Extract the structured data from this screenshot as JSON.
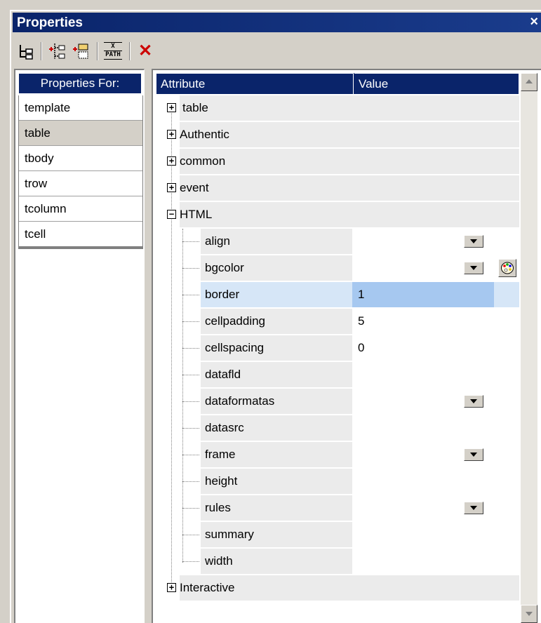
{
  "window": {
    "title": "Properties",
    "close_glyph": "×"
  },
  "toolbar": {
    "buttons": [
      {
        "icon": "tree-view-icon"
      },
      {
        "icon": "add-child-icon"
      },
      {
        "icon": "add-sibling-icon"
      },
      {
        "icon": "xpath-icon",
        "label_top": "X",
        "label_bottom": "PATH"
      },
      {
        "icon": "delete-icon",
        "label": "✕",
        "color": "#cc0000"
      }
    ]
  },
  "left_panel": {
    "header": "Properties For:",
    "items": [
      "template",
      "table",
      "tbody",
      "trow",
      "tcolumn",
      "tcell"
    ],
    "selected": "table"
  },
  "grid": {
    "col_attribute": "Attribute",
    "col_value": "Value",
    "groups": [
      {
        "label": "table",
        "expander": "+"
      },
      {
        "label": "Authentic",
        "expander": "+"
      },
      {
        "label": "common",
        "expander": "+"
      },
      {
        "label": "event",
        "expander": "+"
      },
      {
        "label": "HTML",
        "expander": "−"
      }
    ],
    "html_children": [
      {
        "name": "align",
        "value": "",
        "dropdown": true
      },
      {
        "name": "bgcolor",
        "value": "",
        "dropdown": true,
        "palette": true
      },
      {
        "name": "border",
        "value": "1",
        "selected": true
      },
      {
        "name": "cellpadding",
        "value": "5"
      },
      {
        "name": "cellspacing",
        "value": "0"
      },
      {
        "name": "datafld",
        "value": ""
      },
      {
        "name": "dataformatas",
        "value": "",
        "dropdown": true
      },
      {
        "name": "datasrc",
        "value": ""
      },
      {
        "name": "frame",
        "value": "",
        "dropdown": true
      },
      {
        "name": "height",
        "value": ""
      },
      {
        "name": "rules",
        "value": "",
        "dropdown": true
      },
      {
        "name": "summary",
        "value": ""
      },
      {
        "name": "width",
        "value": ""
      }
    ],
    "last_group": {
      "label": "Interactive",
      "expander": "+"
    }
  },
  "colors": {
    "header_bg": "#0a246a",
    "selected_row": "#a6c8f0",
    "row_bg": "#ebebeb",
    "delete_red": "#cc0000"
  }
}
